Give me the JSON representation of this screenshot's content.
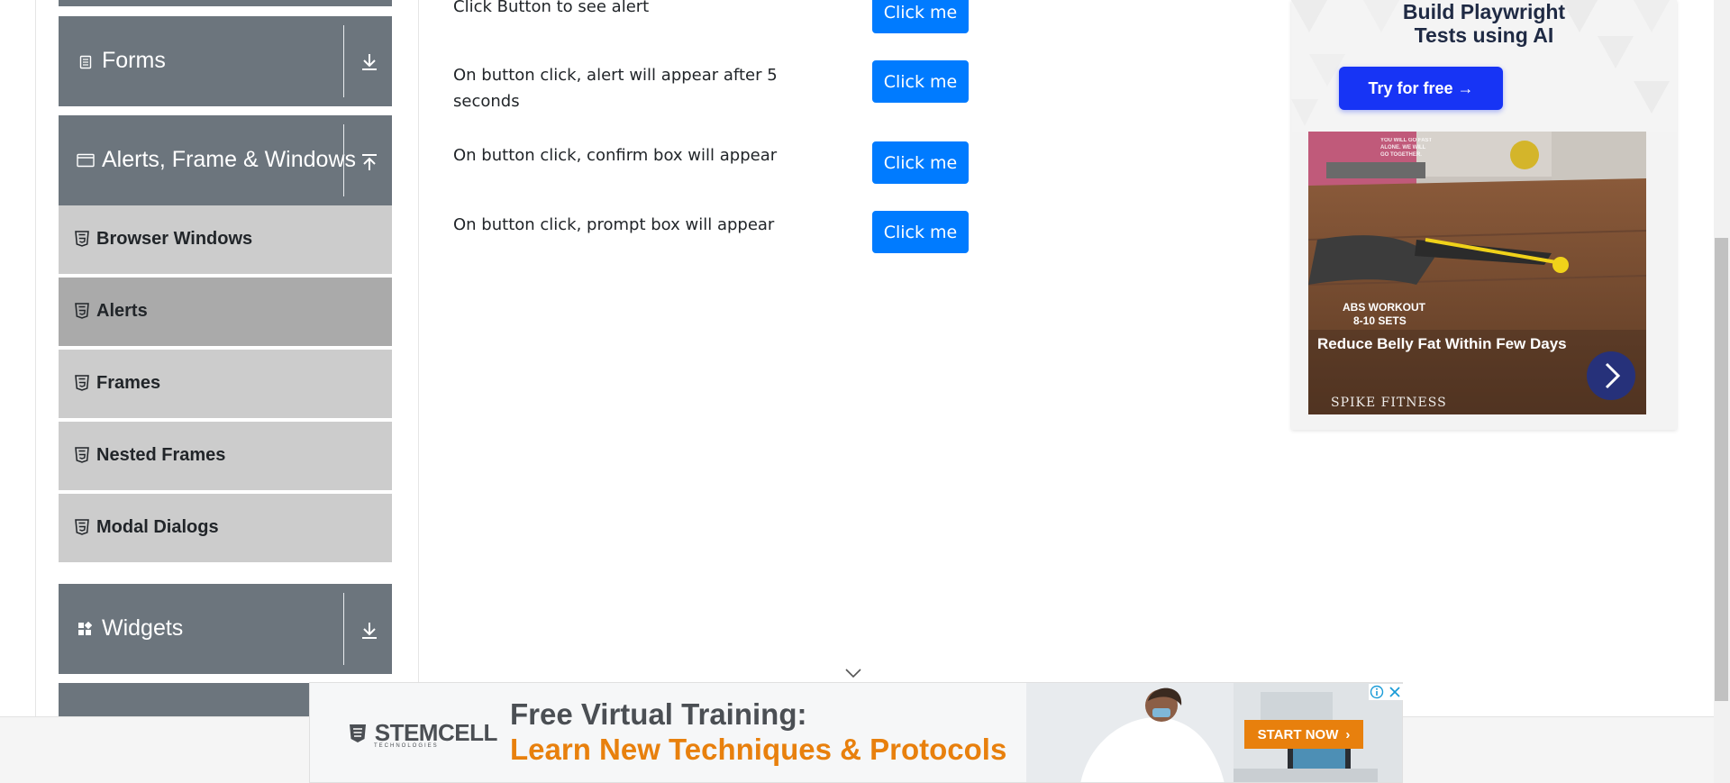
{
  "sidebar": {
    "groups": {
      "forms": {
        "label": "Forms",
        "icon": "document-icon",
        "toggle_icon": "download-arrow-icon"
      },
      "alerts": {
        "label": "Alerts, Frame & Windows",
        "icon": "window-icon",
        "toggle_icon": "upload-arrow-icon"
      },
      "widgets": {
        "label": "Widgets",
        "icon": "widgets-grid-icon",
        "toggle_icon": "download-arrow-icon"
      }
    },
    "items": [
      {
        "label": "Browser Windows",
        "active": false
      },
      {
        "label": "Alerts",
        "active": true
      },
      {
        "label": "Frames",
        "active": false
      },
      {
        "label": "Nested Frames",
        "active": false
      },
      {
        "label": "Modal Dialogs",
        "active": false
      }
    ]
  },
  "main": {
    "rows": [
      {
        "text": "Click Button to see alert",
        "button": "Click me"
      },
      {
        "text": "On button click, alert will appear after 5 seconds",
        "button": "Click me"
      },
      {
        "text": "On button click, confirm box will appear",
        "button": "Click me"
      },
      {
        "text": "On button click, prompt box will appear",
        "button": "Click me"
      }
    ]
  },
  "side_ad": {
    "headline_line1": "Build Playwright",
    "headline_line2": "Tests using AI",
    "cta": "Try for free →",
    "photo_tag_line1": "ABS WORKOUT",
    "photo_tag_line2": "8-10 SETS",
    "photo_title": "Reduce Belly Fat Within Few Days",
    "photo_brand": "SPIKE FITNESS",
    "wall_text": "YOU WILL GO FAST ALONE. WE WILL GO TOGETHER."
  },
  "bottom_ad": {
    "logo": "STEMCELL",
    "logo_sub": "TECHNOLOGIES",
    "line1": "Free Virtual Training:",
    "line2": "Learn New Techniques & Protocols",
    "cta": "START NOW",
    "colors": {
      "accent": "#e8800d",
      "text": "#4b4f54"
    }
  },
  "colors": {
    "group_header": "#6c757d",
    "menu_item": "#cccccc",
    "menu_item_active": "#aaaaaa",
    "button": "#007bff",
    "ad_cta": "#1734f5"
  }
}
